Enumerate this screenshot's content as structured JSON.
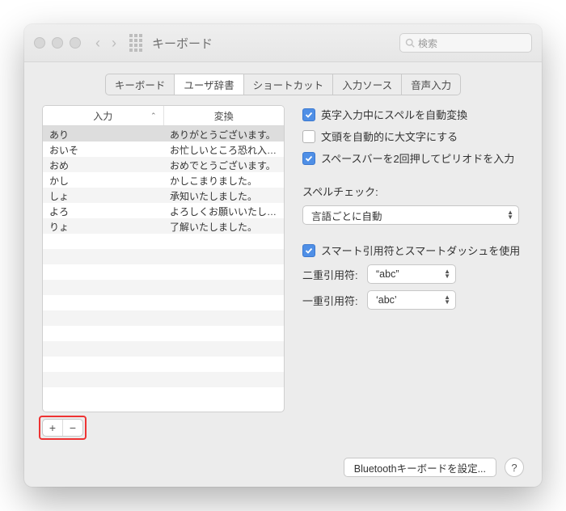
{
  "window": {
    "title": "キーボード",
    "search_placeholder": "検索"
  },
  "tabs": [
    {
      "label": "キーボード"
    },
    {
      "label": "ユーザ辞書",
      "active": true
    },
    {
      "label": "ショートカット"
    },
    {
      "label": "入力ソース"
    },
    {
      "label": "音声入力"
    }
  ],
  "dictionary": {
    "columns": {
      "input": "入力",
      "output": "変換"
    },
    "rows": [
      {
        "in": "あり",
        "out": "ありがとうございます。",
        "selected": true
      },
      {
        "in": "おいそ",
        "out": "お忙しいところ恐れ入り…"
      },
      {
        "in": "おめ",
        "out": "おめでとうございます。"
      },
      {
        "in": "かし",
        "out": "かしこまりました。"
      },
      {
        "in": "しょ",
        "out": "承知いたしました。"
      },
      {
        "in": "よろ",
        "out": "よろしくお願いいたしま…"
      },
      {
        "in": "りょ",
        "out": "了解いたしました。"
      }
    ],
    "add_label": "+",
    "remove_label": "−"
  },
  "options": {
    "auto_correct_en": {
      "checked": true,
      "label": "英字入力中にスペルを自動変換"
    },
    "auto_cap": {
      "checked": false,
      "label": "文頭を自動的に大文字にする"
    },
    "double_space_period": {
      "checked": true,
      "label": "スペースバーを2回押してピリオドを入力"
    },
    "spellcheck_label": "スペルチェック:",
    "spellcheck_value": "言語ごとに自動",
    "smart_quotes": {
      "checked": true,
      "label": "スマート引用符とスマートダッシュを使用"
    },
    "double_quote_label": "二重引用符:",
    "double_quote_value": "“abc”",
    "single_quote_label": "一重引用符:",
    "single_quote_value": "‘abc’"
  },
  "footer": {
    "bluetooth_btn": "Bluetoothキーボードを設定...",
    "help": "?"
  }
}
